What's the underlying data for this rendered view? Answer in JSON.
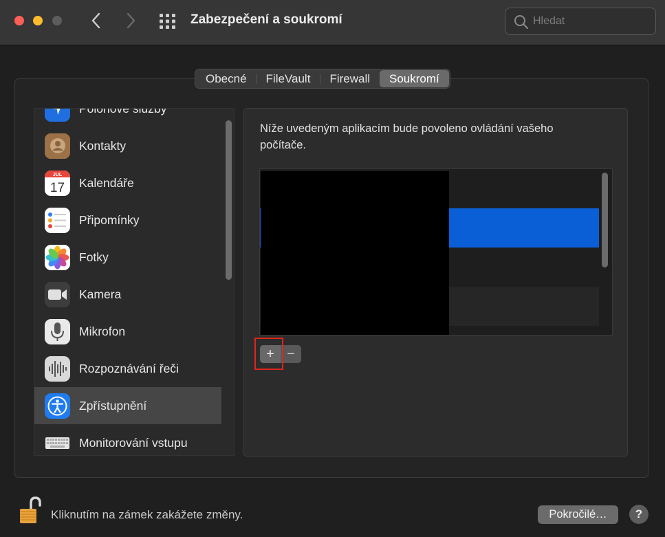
{
  "window": {
    "title": "Zabezpečení a soukromí",
    "search_placeholder": "Hledat"
  },
  "tabs": [
    {
      "label": "Obecné",
      "active": false
    },
    {
      "label": "FileVault",
      "active": false
    },
    {
      "label": "Firewall",
      "active": false
    },
    {
      "label": "Soukromí",
      "active": true
    }
  ],
  "sidebar": {
    "items": [
      {
        "label": "Polohové služby",
        "icon": "location-arrow-icon"
      },
      {
        "label": "Kontakty",
        "icon": "contacts-icon"
      },
      {
        "label": "Kalendáře",
        "icon": "calendar-icon",
        "cal_month": "JUL",
        "cal_day": "17"
      },
      {
        "label": "Připomínky",
        "icon": "reminders-icon"
      },
      {
        "label": "Fotky",
        "icon": "photos-icon"
      },
      {
        "label": "Kamera",
        "icon": "camera-icon"
      },
      {
        "label": "Mikrofon",
        "icon": "microphone-icon"
      },
      {
        "label": "Rozpoznávání řeči",
        "icon": "waveform-icon"
      },
      {
        "label": "Zpřístupnění",
        "icon": "accessibility-icon",
        "selected": true
      },
      {
        "label": "Monitorování vstupu",
        "icon": "keyboard-icon"
      }
    ]
  },
  "main": {
    "description": "Níže uvedeným aplikacím bude povoleno ovládání vašeho počítače.",
    "add_label": "+",
    "remove_label": "−"
  },
  "footer": {
    "lock_text": "Kliknutím na zámek zakážete změny.",
    "advanced_label": "Pokročilé…",
    "help_label": "?"
  },
  "colors": {
    "accent": "#0a5fd6",
    "highlight": "#e0261b"
  }
}
